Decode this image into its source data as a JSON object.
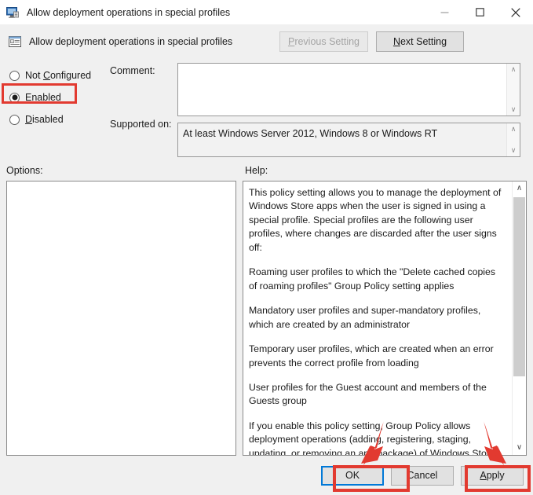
{
  "window": {
    "title": "Allow deployment operations in special profiles",
    "title_icon": "policy-monitor-icon",
    "minimize_label": "Minimize",
    "maximize_label": "Maximize",
    "close_label": "Close"
  },
  "header": {
    "policy_icon": "policy-setting-icon",
    "policy_title": "Allow deployment operations in special profiles",
    "previous_setting_label": "Previous Setting",
    "previous_setting_accel": "P",
    "previous_setting_disabled": true,
    "next_setting_label": "Next Setting",
    "next_setting_accel": "N"
  },
  "state": {
    "selected_option": "Enabled",
    "options": [
      {
        "id": "not-configured",
        "label": "Not Configured",
        "accel": "C",
        "pre": "Not ",
        "post": "onfigured",
        "checked": false
      },
      {
        "id": "enabled",
        "label": "Enabled",
        "accel": "E",
        "pre": "",
        "post": "nabled",
        "checked": true
      },
      {
        "id": "disabled",
        "label": "Disabled",
        "accel": "D",
        "pre": "",
        "post": "isabled",
        "checked": false
      }
    ]
  },
  "fields": {
    "comment_label": "Comment:",
    "comment_value": "",
    "comment_placeholder": "",
    "supported_on_label": "Supported on:",
    "supported_on_value": "At least Windows Server 2012, Windows 8 or Windows RT"
  },
  "sections": {
    "options_label": "Options:",
    "help_label": "Help:"
  },
  "options_pane": {
    "content": ""
  },
  "help": {
    "paragraphs": [
      "This policy setting allows you to manage the deployment of Windows Store apps when the user is signed in using a special profile. Special profiles are the following user profiles, where changes are discarded after the user signs off:",
      "Roaming user profiles to which the \"Delete cached copies of roaming profiles\" Group Policy setting applies",
      "Mandatory user profiles and super-mandatory profiles, which are created by an administrator",
      "Temporary user profiles, which are created when an error prevents the correct profile from loading",
      "User profiles for the Guest account and members of the Guests group",
      "If you enable this policy setting, Group Policy allows deployment operations (adding, registering, staging, updating, or removing an app package) of Windows Store apps when using a special"
    ],
    "scroll_up_glyph": "∧",
    "scroll_down_glyph": "∨"
  },
  "footer": {
    "ok_label": "OK",
    "cancel_label": "Cancel",
    "apply_label": "Apply",
    "apply_accel": "A"
  },
  "annotations": {
    "highlight_color": "#e23a30",
    "enabled_box": "red-highlight-enabled",
    "ok_box": "red-highlight-ok",
    "apply_box": "red-highlight-apply",
    "arrow_to_ok": "red-arrow-pointing-to-ok",
    "arrow_to_apply": "red-arrow-pointing-to-apply"
  }
}
